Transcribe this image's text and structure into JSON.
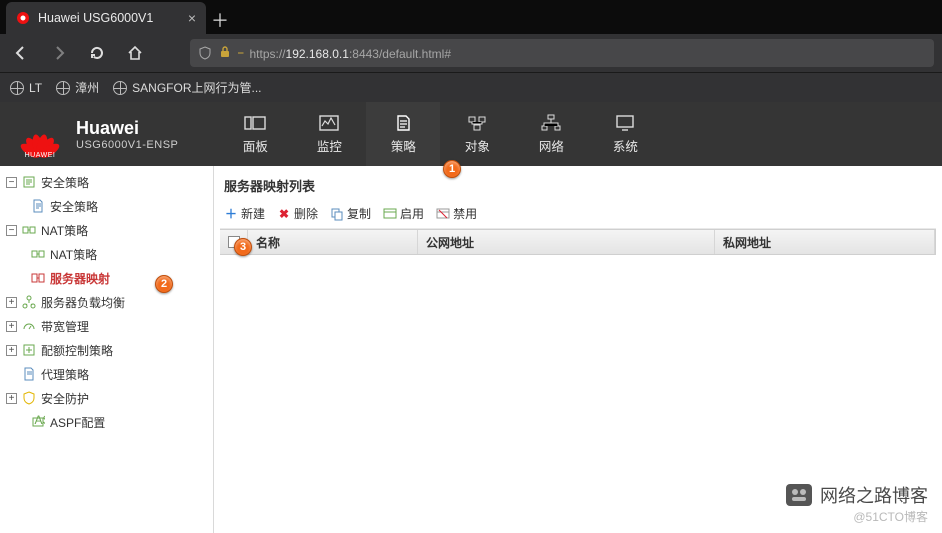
{
  "browser": {
    "tab_title": "Huawei USG6000V1",
    "url_prefix": "https://",
    "url_host": "192.168.0.1",
    "url_path": ":8443/default.html#",
    "bookmarks": [
      "LT",
      "漳州",
      "SANGFOR上网行为管..."
    ]
  },
  "brand": {
    "name": "Huawei",
    "logo_text": "HUAWEI",
    "model": "USG6000V1-ENSP"
  },
  "top_tabs": [
    {
      "label": "面板"
    },
    {
      "label": "监控"
    },
    {
      "label": "策略"
    },
    {
      "label": "对象"
    },
    {
      "label": "网络"
    },
    {
      "label": "系统"
    }
  ],
  "tree": {
    "n_sec": {
      "label": "安全策略",
      "pm": "−"
    },
    "n_sec_pol": {
      "label": "安全策略"
    },
    "n_nat": {
      "label": "NAT策略",
      "pm": "−"
    },
    "n_nat_pol": {
      "label": "NAT策略"
    },
    "n_srv_map": {
      "label": "服务器映射"
    },
    "n_slb": {
      "label": "服务器负载均衡",
      "pm": "+"
    },
    "n_bw": {
      "label": "带宽管理",
      "pm": "+"
    },
    "n_quota": {
      "label": "配额控制策略",
      "pm": "+"
    },
    "n_proxy": {
      "label": "代理策略"
    },
    "n_secdef": {
      "label": "安全防护",
      "pm": "+"
    },
    "n_aspf": {
      "label": "ASPF配置"
    }
  },
  "callouts": {
    "c1": "1",
    "c2": "2",
    "c3": "3"
  },
  "panel": {
    "title": "服务器映射列表",
    "toolbar": {
      "new": "新建",
      "delete": "删除",
      "copy": "复制",
      "enable": "启用",
      "disable": "禁用"
    },
    "columns": {
      "name": "名称",
      "public_ip": "公网地址",
      "private_ip": "私网地址"
    }
  },
  "watermark": {
    "main": "网络之路博客",
    "sub": "@51CTO博客"
  }
}
